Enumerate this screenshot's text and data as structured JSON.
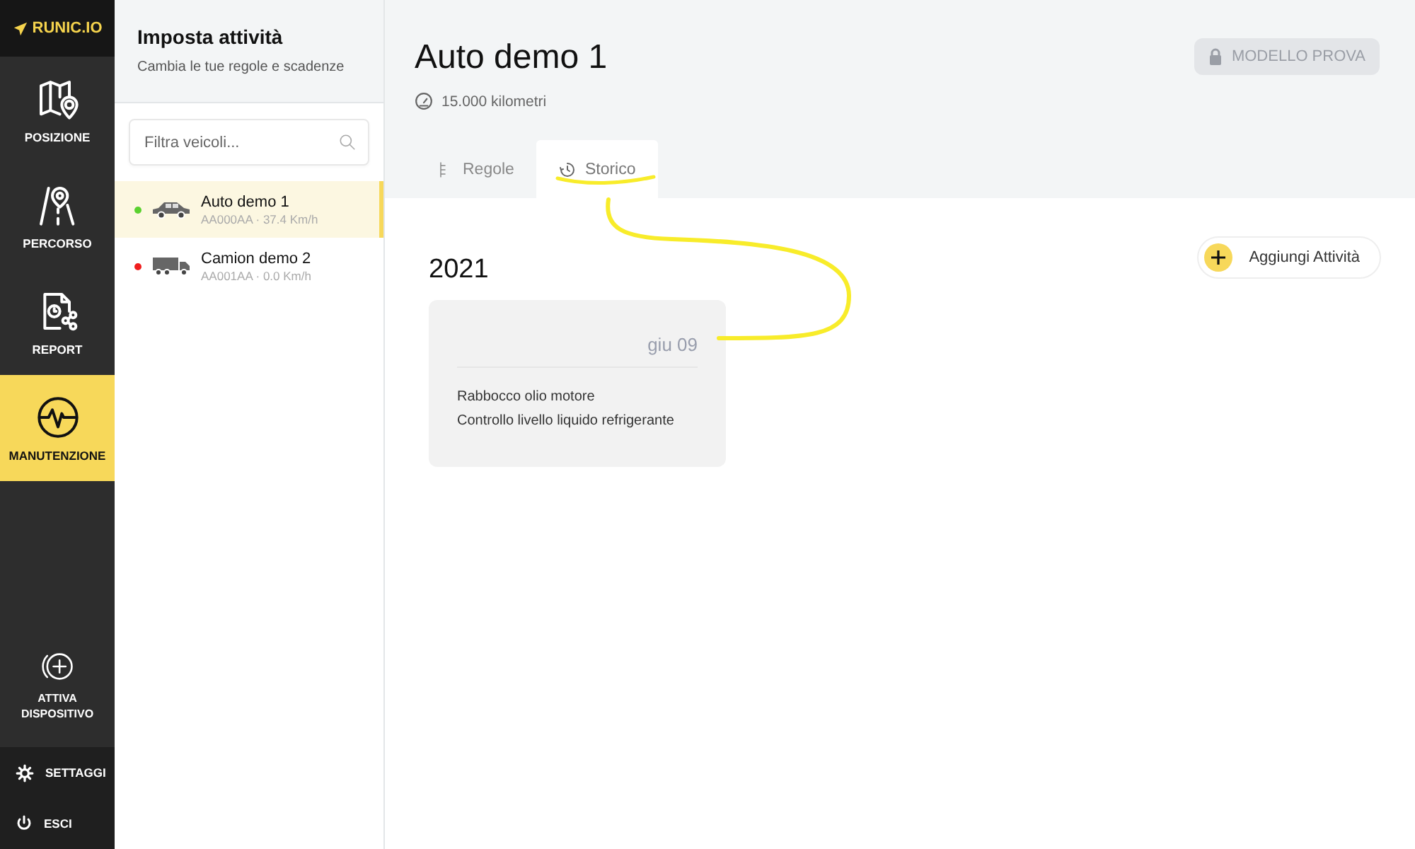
{
  "logo": {
    "text": "RUNIC.IO"
  },
  "nav": {
    "items": [
      {
        "label": "POSIZIONE",
        "kind": "map",
        "selected": false
      },
      {
        "label": "PERCORSO",
        "kind": "route",
        "selected": false
      },
      {
        "label": "REPORT",
        "kind": "report",
        "selected": false
      },
      {
        "label": "MANUTENZIONE",
        "kind": "pulse",
        "selected": true
      }
    ],
    "activate": {
      "lines": [
        "ATTIVA",
        "DISPOSITIVO"
      ]
    },
    "bottom": [
      {
        "label": "SETTAGGI",
        "kind": "settings"
      },
      {
        "label": "ESCI",
        "kind": "power"
      }
    ]
  },
  "panel": {
    "title": "Imposta attività",
    "subtitle": "Cambia le tue regole e scadenze",
    "search": {
      "placeholder": "Filtra veicoli..."
    },
    "vehicles": [
      {
        "name": "Auto demo 1",
        "detail": "AA000AA · 37.4 Km/h",
        "kind": "car",
        "color": "#5ad12f",
        "selected": true
      },
      {
        "name": "Camion demo 2",
        "detail": "AA001AA · 0.0 Km/h",
        "kind": "truck",
        "color": "#f01e1e",
        "selected": false
      }
    ]
  },
  "main": {
    "title": "Auto demo 1",
    "odometer": "15.000 kilometri",
    "badge": "MODELLO PROVA",
    "tabs": [
      {
        "label": "Regole",
        "kind": "rules",
        "selected": false
      },
      {
        "label": "Storico",
        "kind": "history",
        "selected": true
      }
    ],
    "year": "2021",
    "add_button": "Aggiungi Attività",
    "entries": [
      {
        "date": "giu 09",
        "tasks": [
          "Rabbocco olio motore",
          "Controllo livello liquido refrigerante"
        ]
      }
    ]
  }
}
